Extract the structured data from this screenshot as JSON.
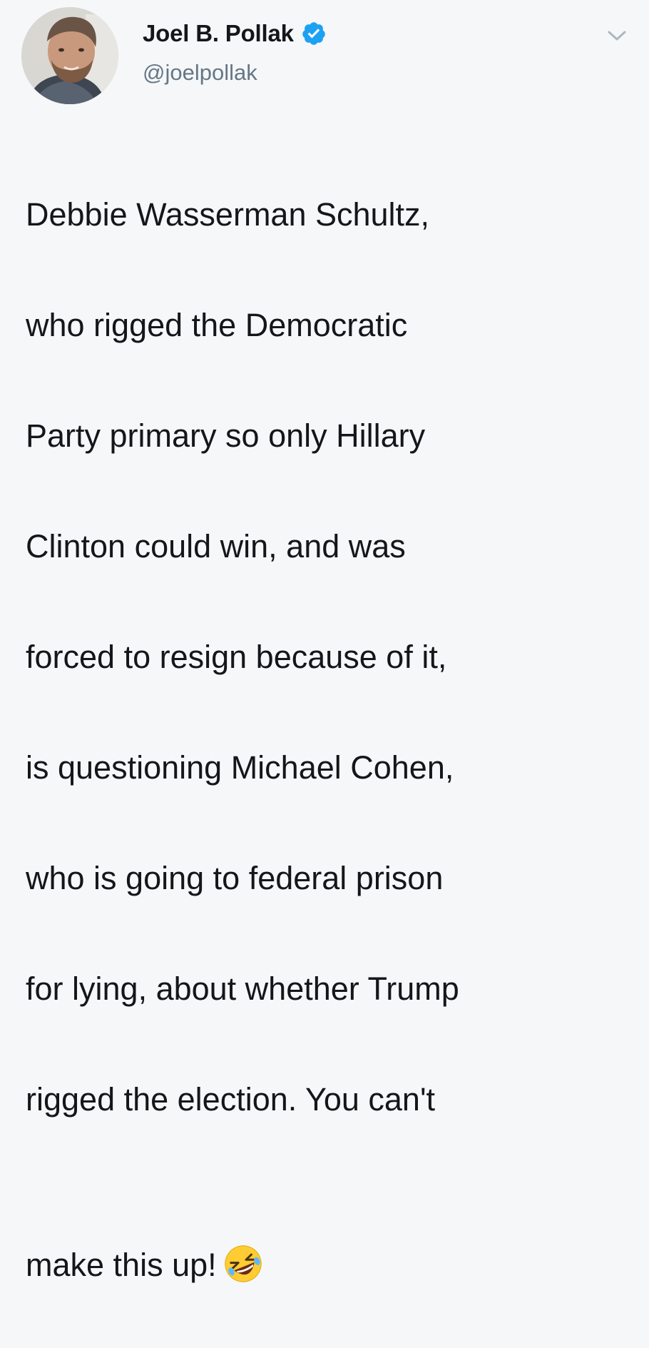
{
  "tweet": {
    "author": {
      "display_name": "Joel B. Pollak",
      "handle": "@joelpollak",
      "verified": true,
      "avatar_icon": "profile-photo"
    },
    "text_lines": [
      "Debbie Wasserman Schultz,",
      "who rigged the Democratic",
      "Party primary so only Hillary",
      "Clinton could win, and was",
      "forced to resign because of it,",
      "is questioning Michael Cohen,",
      "who is going to federal prison",
      "for lying, about whether Trump",
      "rigged the election. You can't",
      "make this up!"
    ],
    "emoji": "rolling-on-floor-laughing",
    "menu_icon": "chevron-down-icon"
  },
  "colors": {
    "background": "#f6f7f9",
    "text": "#14171a",
    "handle": "#657786",
    "verified_badge": "#1da1f2",
    "caret": "#aab8c2"
  }
}
